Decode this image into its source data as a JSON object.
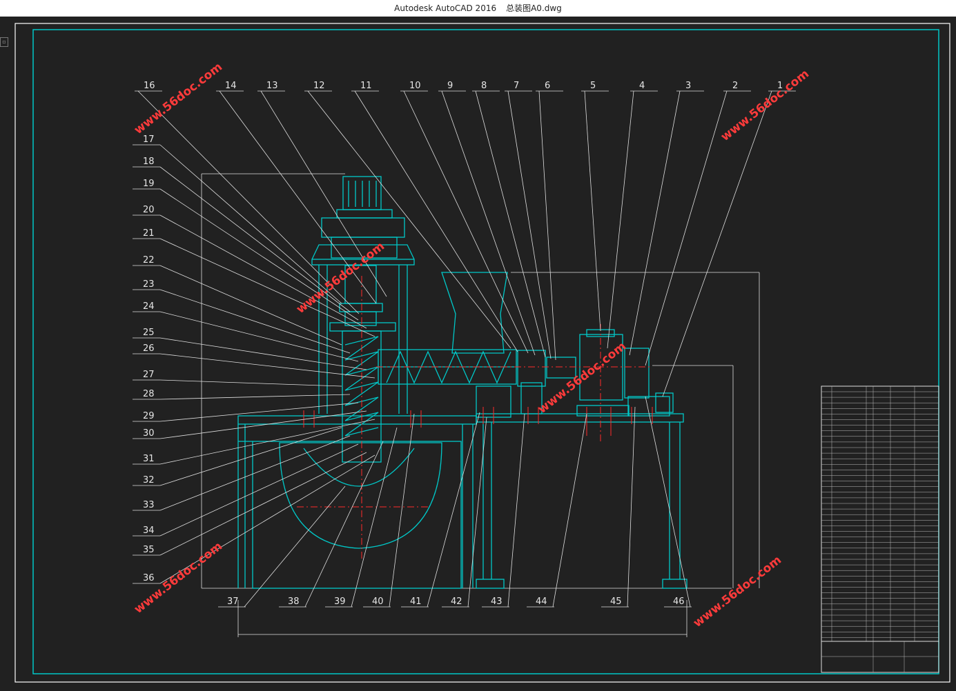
{
  "window": {
    "app": "Autodesk AutoCAD 2016",
    "file": "总装图A0.dwg"
  },
  "drawing": {
    "top_callouts": [
      "16",
      "14",
      "13",
      "12",
      "11",
      "10",
      "9",
      "8",
      "7",
      "6",
      "5",
      "4",
      "3",
      "2",
      "1"
    ],
    "left_callouts": [
      "17",
      "18",
      "19",
      "20",
      "21",
      "22",
      "23",
      "24",
      "25",
      "26",
      "27",
      "28",
      "29",
      "30",
      "31",
      "32",
      "33",
      "34",
      "35",
      "36"
    ],
    "bottom_callouts": [
      "37",
      "38",
      "39",
      "40",
      "41",
      "42",
      "43",
      "44",
      "45",
      "46"
    ],
    "watermark": "www.56doc.com",
    "colors": {
      "frame": "#00c8c8",
      "border": "#ffffff",
      "centerline": "#ff2a2a",
      "leader": "#e0e0e0",
      "background": "#212121"
    }
  }
}
